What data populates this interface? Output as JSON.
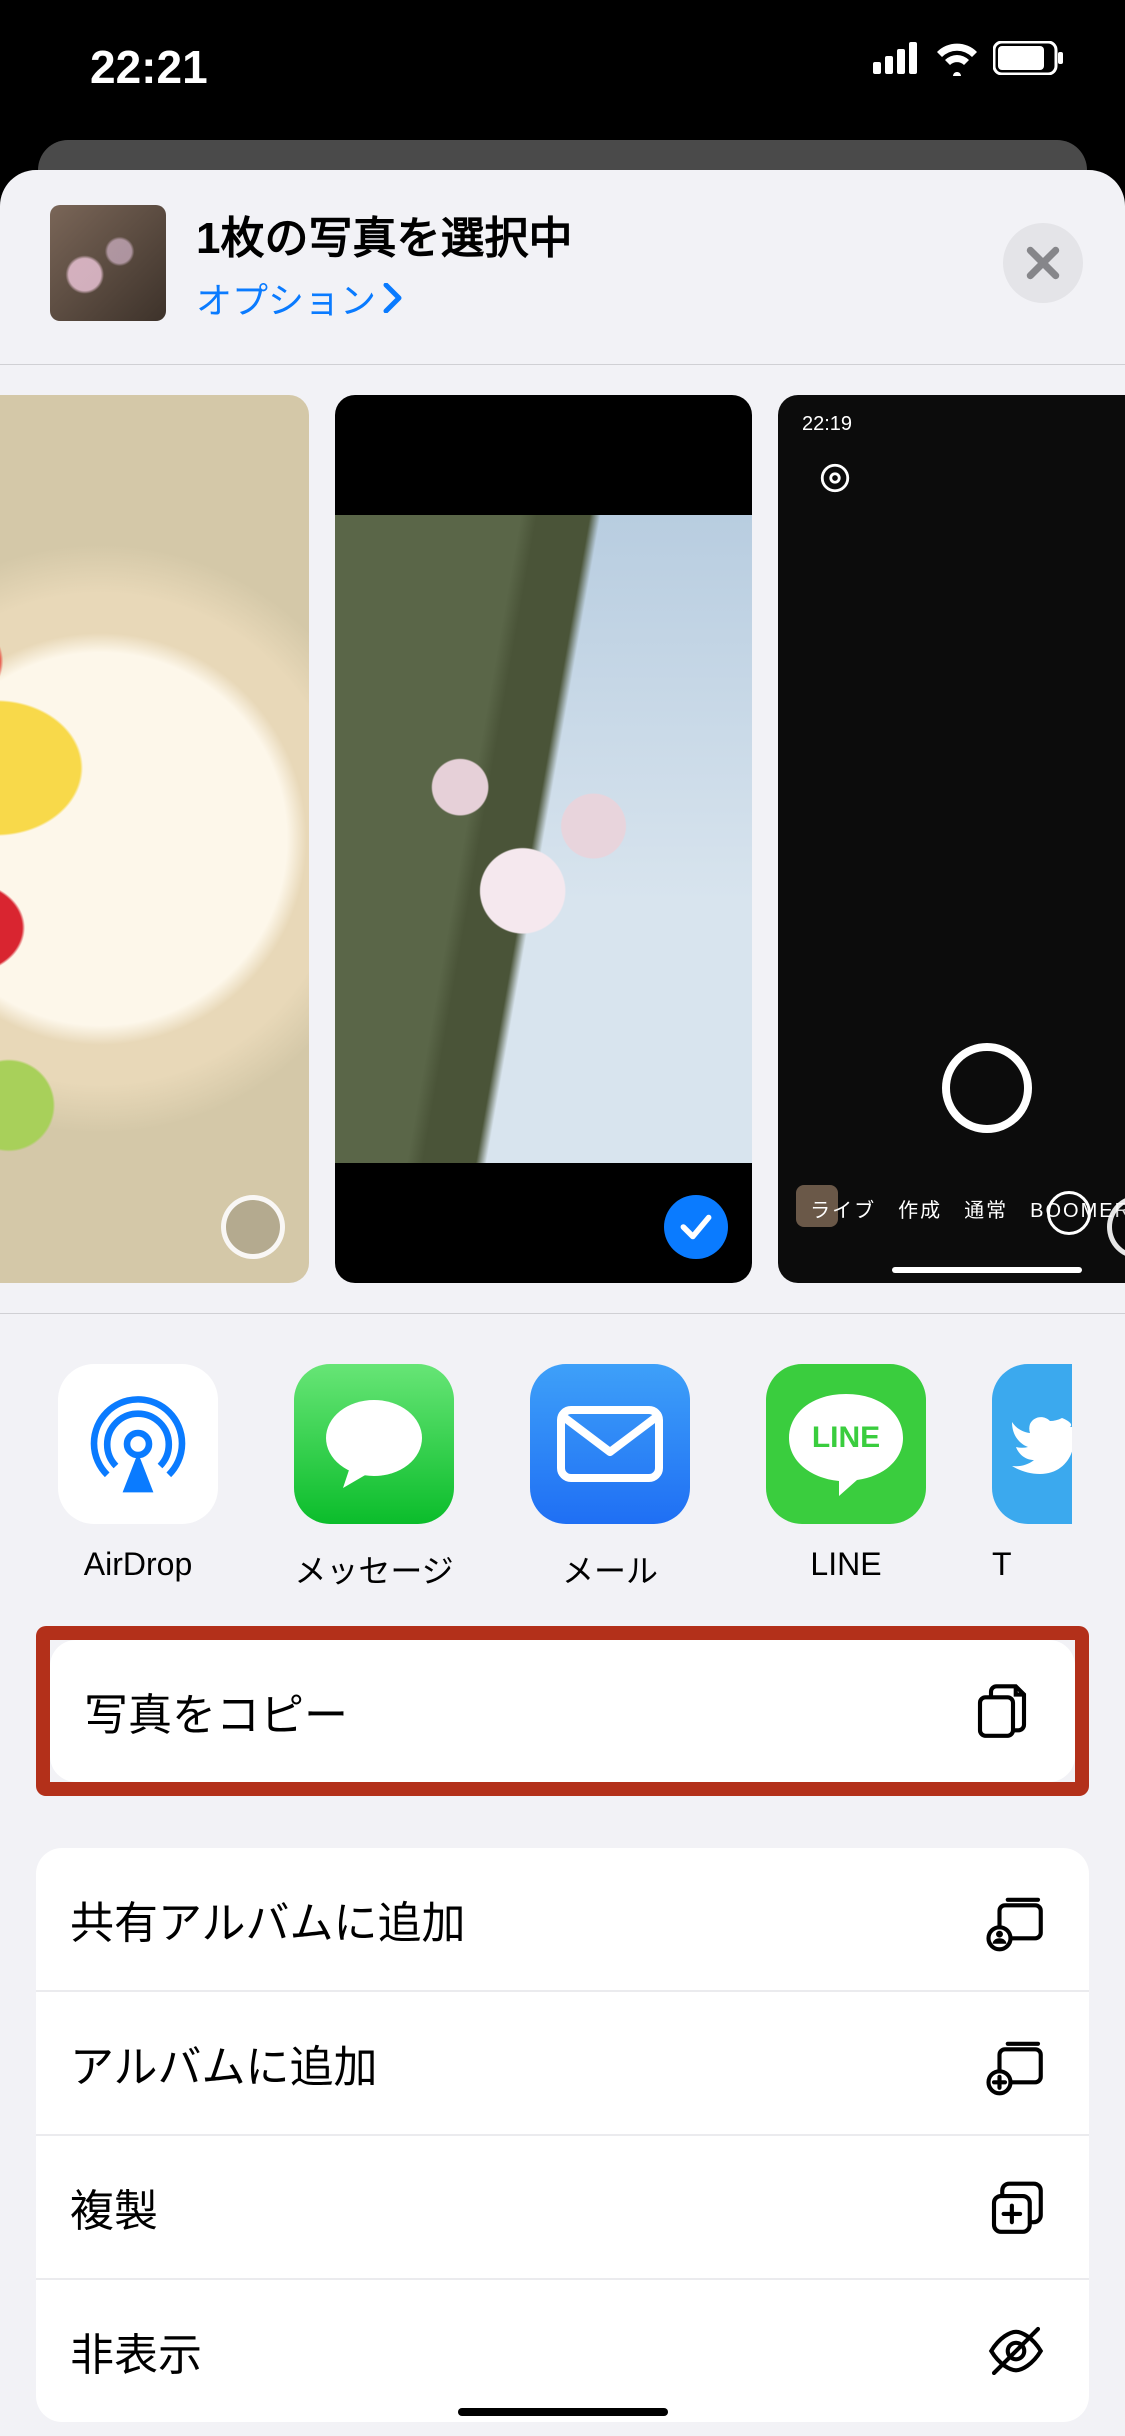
{
  "status": {
    "time": "22:21"
  },
  "header": {
    "title": "1枚の写真を選択中",
    "options_label": "オプション"
  },
  "photos": {
    "p3_time": "22:19",
    "p3_modes": "ライブ　作成　通常　BOOMERAN"
  },
  "apps": [
    {
      "id": "airdrop",
      "label": "AirDrop"
    },
    {
      "id": "messages",
      "label": "メッセージ"
    },
    {
      "id": "mail",
      "label": "メール"
    },
    {
      "id": "line",
      "label": "LINE"
    },
    {
      "id": "twitter",
      "label": "T"
    }
  ],
  "actions": {
    "copy_photo": "写真をコピー",
    "add_shared_album": "共有アルバムに追加",
    "add_album": "アルバムに追加",
    "duplicate": "複製",
    "hide": "非表示"
  }
}
